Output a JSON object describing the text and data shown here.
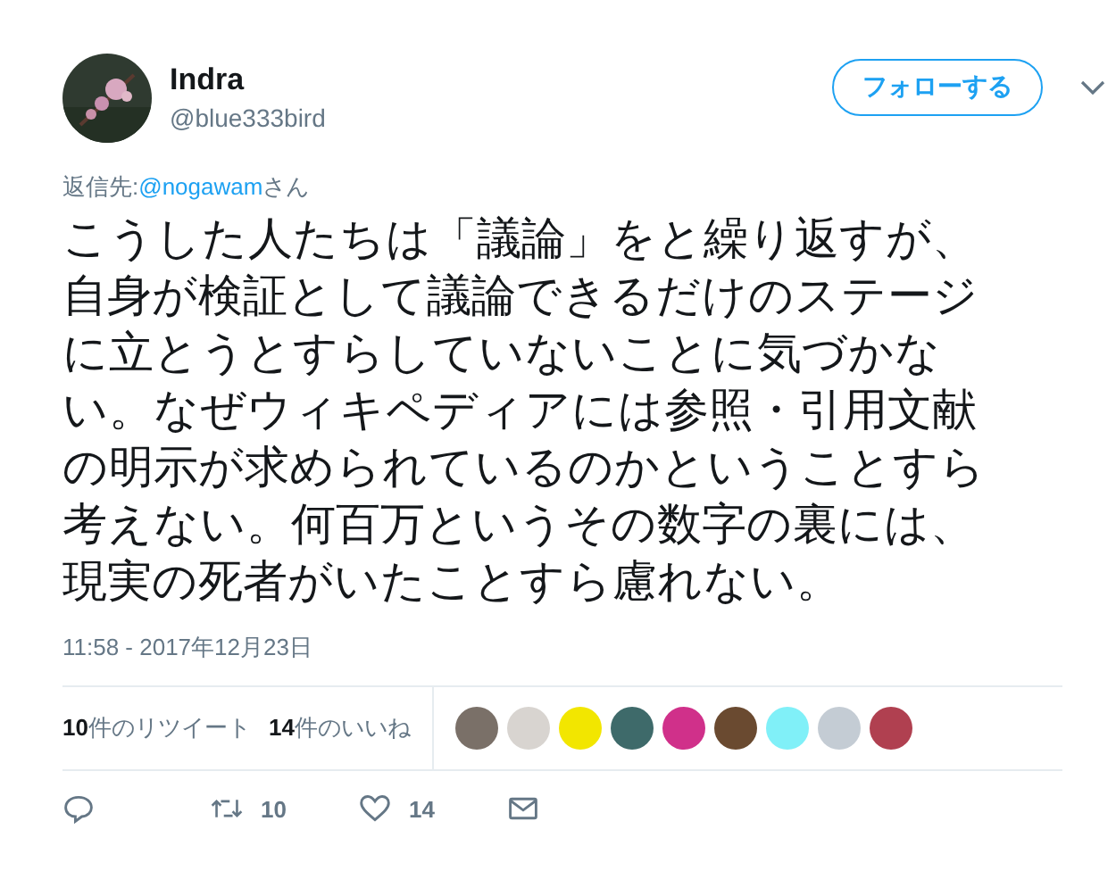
{
  "author": {
    "name": "Indra",
    "handle": "@blue333bird"
  },
  "follow_button": "フォローする",
  "reply_to": {
    "label": "返信先:",
    "handle": "@nogawam",
    "suffix": "さん"
  },
  "text_lines": [
    "こうした人たちは「議論」をと繰り返すが、",
    "自身が検証として議論できるだけのステージ",
    "に立とうとすらしていないことに気づかな",
    "い。なぜウィキペディアには参照・引用文献",
    "の明示が求められているのかということすら",
    "考えない。何百万というその数字の裏には、",
    "現実の死者がいたことすら慮れない。"
  ],
  "timestamp": "11:58 - 2017年12月23日",
  "stats": [
    "**10**件のリツイート",
    "**14**件のいいね"
  ],
  "likers": [
    {
      "color": "#7a7068"
    },
    {
      "color": "#d8d4d0"
    },
    {
      "color": "#f2e600"
    },
    {
      "color": "#3e6a6a"
    },
    {
      "color": "#d0308a"
    },
    {
      "color": "#6a4a30"
    },
    {
      "color": "#80f0f8"
    },
    {
      "color": "#c4ccd4"
    },
    {
      "color": "#b04050"
    }
  ],
  "actions": [
    {
      "kind": "reply"
    },
    {
      "kind": "retweet",
      "count": "10"
    },
    {
      "kind": "like",
      "count": "14"
    },
    {
      "kind": "message"
    }
  ]
}
